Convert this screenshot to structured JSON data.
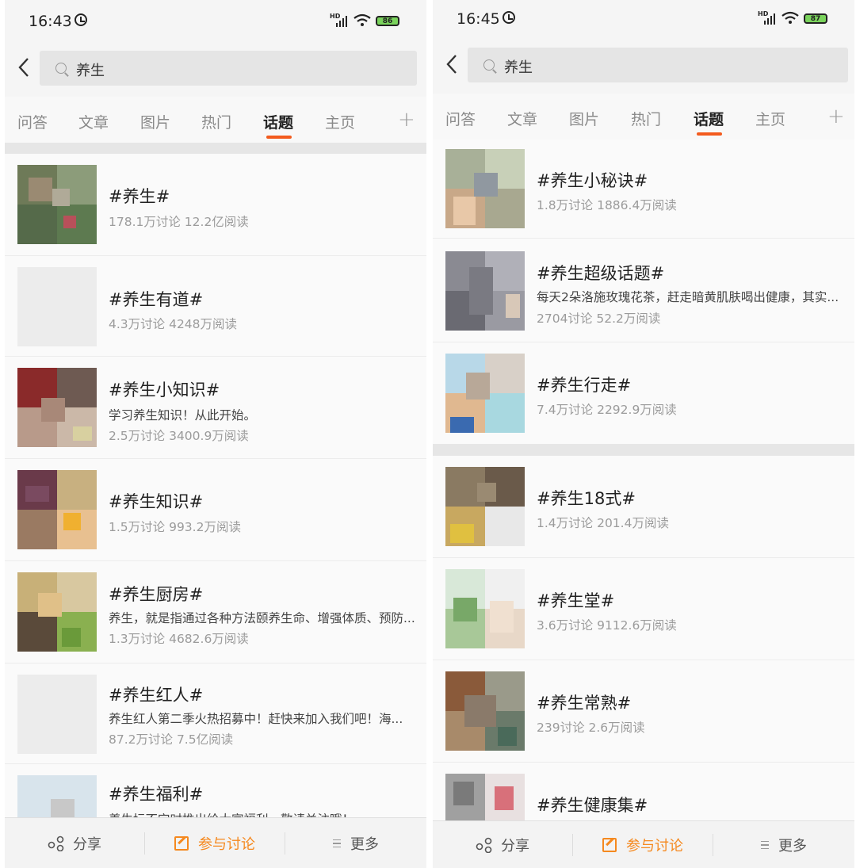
{
  "screens": [
    {
      "status": {
        "time": "16:43",
        "battery": "86"
      },
      "search": {
        "query": "养生"
      },
      "tabs": [
        {
          "label": "问答"
        },
        {
          "label": "文章"
        },
        {
          "label": "图片"
        },
        {
          "label": "热门"
        },
        {
          "label": "话题",
          "active": true
        },
        {
          "label": "主页"
        }
      ],
      "items": [
        {
          "title": "#养生#",
          "desc": "",
          "meta": "178.1万讨论 12.2亿阅读"
        },
        {
          "title": "#养生有道#",
          "desc": "",
          "meta": "4.3万讨论 4248万阅读"
        },
        {
          "title": "#养生小知识#",
          "desc": "学习养生知识！从此开始。",
          "meta": "2.5万讨论 3400.9万阅读"
        },
        {
          "title": "#养生知识#",
          "desc": "",
          "meta": "1.5万讨论 993.2万阅读"
        },
        {
          "title": "#养生厨房#",
          "desc": "养生，就是指通过各种方法颐养生命、增强体质、预防...",
          "meta": "1.3万讨论 4682.6万阅读"
        },
        {
          "title": "#养生红人#",
          "desc": "养生红人第二季火热招募中！赶快来加入我们吧！海...",
          "meta": "87.2万讨论 7.5亿阅读"
        },
        {
          "title": "#养生福利#",
          "desc": "养生坛不定时推出给大家福利，敬请关注哦！",
          "meta": ""
        }
      ],
      "bottom": {
        "share": "分享",
        "discuss": "参与讨论",
        "more": "更多"
      }
    },
    {
      "status": {
        "time": "16:45",
        "battery": "87"
      },
      "search": {
        "query": "养生"
      },
      "tabs": [
        {
          "label": "问答"
        },
        {
          "label": "文章"
        },
        {
          "label": "图片"
        },
        {
          "label": "热门"
        },
        {
          "label": "话题",
          "active": true
        },
        {
          "label": "主页"
        }
      ],
      "items": [
        {
          "title": "#养生小秘诀#",
          "desc": "",
          "meta": "1.8万讨论 1886.4万阅读"
        },
        {
          "title": "#养生超级话题#",
          "desc": "每天2朵洛施玫瑰花茶，赶走暗黄肌肤喝出健康，其实...",
          "meta": "2704讨论 52.2万阅读"
        },
        {
          "title": "#养生行走#",
          "desc": "",
          "meta": "7.4万讨论 2292.9万阅读"
        },
        {
          "title": "#养生18式#",
          "desc": "",
          "meta": "1.4万讨论 201.4万阅读"
        },
        {
          "title": "#养生堂#",
          "desc": "",
          "meta": "3.6万讨论 9112.6万阅读"
        },
        {
          "title": "#养生常熟#",
          "desc": "",
          "meta": "239讨论 2.6万阅读"
        },
        {
          "title": "#养生健康集#",
          "desc": "",
          "meta": ""
        }
      ],
      "bottom": {
        "share": "分享",
        "discuss": "参与讨论",
        "more": "更多"
      }
    }
  ],
  "colors": {
    "accent": "#f35b1e",
    "discuss": "#f5891f"
  }
}
